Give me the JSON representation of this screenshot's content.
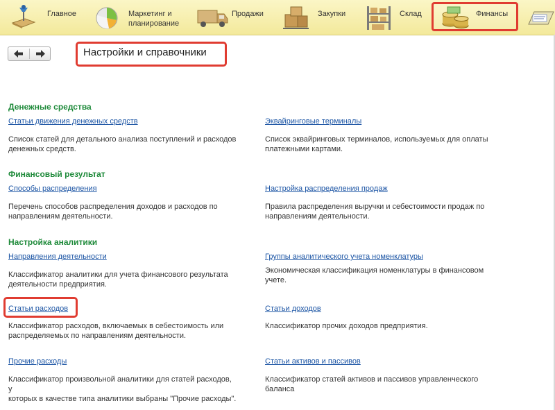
{
  "sections": [
    {
      "id": "main",
      "label_lines": [
        "Главное"
      ],
      "icon": "home-desk-icon"
    },
    {
      "id": "marketing",
      "label_lines": [
        "Маркетинг и",
        "планирование"
      ],
      "icon": "pie-chart-icon"
    },
    {
      "id": "sales",
      "label_lines": [
        "Продажи"
      ],
      "icon": "delivery-truck-icon"
    },
    {
      "id": "purchases",
      "label_lines": [
        "Закупки"
      ],
      "icon": "boxes-cart-icon"
    },
    {
      "id": "warehouse",
      "label_lines": [
        "Склад"
      ],
      "icon": "warehouse-shelf-icon"
    },
    {
      "id": "finance",
      "label_lines": [
        "Финансы"
      ],
      "icon": "coins-icon",
      "active": true
    },
    {
      "id": "more",
      "label_lines": [
        ""
      ],
      "icon": "folder-icon"
    }
  ],
  "nav": {
    "back_icon": "arrow-left-icon",
    "forward_icon": "arrow-right-icon"
  },
  "page_title": "Настройки и справочники",
  "groups": [
    {
      "title": "Денежные средства",
      "items": [
        {
          "link": "Статьи движения денежных средств",
          "desc_lines": [
            "Список статей для детального анализа поступлений и расходов",
            "денежных средств."
          ]
        },
        {
          "link": "Эквайринговые терминалы",
          "desc_lines": [
            "Список эквайринговых терминалов, используемых для оплаты",
            "платежными картами."
          ]
        }
      ]
    },
    {
      "title": "Финансовый результат",
      "items": [
        {
          "link": "Способы распределения",
          "desc_lines": [
            "Перечень способов распределения доходов и расходов по",
            "направлениям деятельности."
          ]
        },
        {
          "link": "Настройка распределения продаж",
          "desc_lines": [
            "Правила распределения выручки и себестоимости продаж по",
            "направлениям деятельности."
          ]
        }
      ]
    },
    {
      "title": "Настройка аналитики",
      "items": [
        {
          "link": "Направления деятельности",
          "desc_lines": [
            "Классификатор аналитики для учета финансового результата",
            "деятельности предприятия."
          ]
        },
        {
          "link": "Группы аналитического учета номенклатуры",
          "desc_lines": [
            "Экономическая классификация номенклатуры в финансовом учете."
          ]
        },
        {
          "link": "Статьи расходов",
          "desc_lines": [
            "Классификатор расходов, включаемых в себестоимость или",
            "распределяемых по направлениям деятельности."
          ],
          "highlighted": true
        },
        {
          "link": "Статьи доходов",
          "desc_lines": [
            "Классификатор прочих доходов предприятия."
          ]
        },
        {
          "link": "Прочие расходы",
          "desc_lines": [
            "Классификатор произвольной аналитики для статей расходов, у",
            "которых в качестве типа аналитики выбраны \"Прочие расходы\"."
          ]
        },
        {
          "link": "Статьи активов и пассивов",
          "desc_lines": [
            "Классификатор статей активов и пассивов управленческого баланса"
          ]
        }
      ]
    }
  ],
  "colors": {
    "accent_red": "#e03c31",
    "group_title_green": "#1e8a3a",
    "link_blue": "#1b54a4",
    "topbar_yellow": "#f3e99b"
  }
}
